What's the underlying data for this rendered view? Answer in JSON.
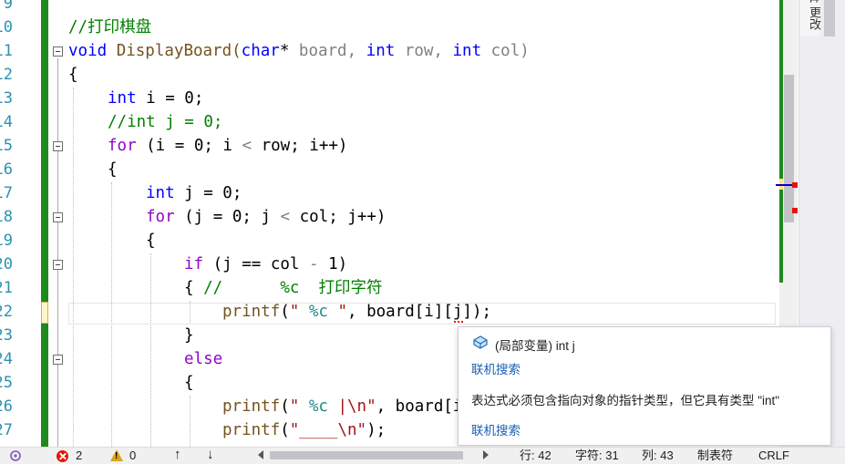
{
  "editor": {
    "line_numbers": [
      "9",
      "10",
      "11",
      "12",
      "13",
      "14",
      "15",
      "16",
      "17",
      "18",
      "19",
      "20",
      "21",
      "22",
      "23",
      "24",
      "25",
      "26",
      "27"
    ],
    "lines": [
      {
        "comment": "//打印棋盘"
      },
      {
        "kw_void": "void",
        "fn_name": " DisplayBoard(",
        "ty_char": "char",
        "star": "*",
        "p1": " board, ",
        "kw_int1": "int",
        "p2": " row, ",
        "kw_int2": "int",
        "p3": " col)"
      },
      {
        "brace": "{"
      },
      {
        "kw": "int",
        "rest": " i = 0;"
      },
      {
        "comment": "//int j = 0;"
      },
      {
        "kw": "for",
        "rest_a": " (i = 0; i ",
        "lt": "<",
        "rest_b": " row; i++)"
      },
      {
        "brace": "{"
      },
      {
        "kw": "int",
        "rest": " j = 0;"
      },
      {
        "kw": "for",
        "rest_a": " (j = 0; j ",
        "lt": "<",
        "rest_b": " col; j++)"
      },
      {
        "brace": "{"
      },
      {
        "kw": "if",
        "rest_a": " (j == col ",
        "minus": "-",
        "rest_b": " 1)"
      },
      {
        "brace": "{",
        "comment": " //      %c  打印字符"
      },
      {
        "fn": "printf",
        "open": "(",
        "str_a": "\" ",
        "fmt": "%c",
        "str_b": " \"",
        "rest": ", board[i][j]);"
      },
      {
        "brace": "}"
      },
      {
        "kw": "else"
      },
      {
        "brace": "{"
      },
      {
        "fn": "printf",
        "open": "(",
        "str_a": "\" ",
        "fmt": "%c",
        "str_b": " |\\n\"",
        "rest": ", board[i"
      },
      {
        "fn": "printf",
        "open": "(",
        "str_a": "\"____\\n\"",
        "rest": ");"
      }
    ]
  },
  "right_panel": {
    "tab_label": "t 更改"
  },
  "tooltip": {
    "symbol_line": "(局部变量) int j",
    "link1": "联机搜索",
    "error_message": "表达式必须包含指向对象的指针类型，但它具有类型 \"int\"",
    "link2": "联机搜索"
  },
  "statusbar": {
    "error_count": "2",
    "warning_count": "0",
    "up_arrow": "↑",
    "down_arrow": "↓",
    "line": "行: 42",
    "char": "字符: 31",
    "col": "列: 43",
    "tabs": "制表符",
    "eol": "CRLF"
  },
  "colors": {
    "keyword": "#0000ff",
    "type": "#2b91af",
    "comment": "#008000",
    "string": "#a31515",
    "control": "#8f08c4",
    "change_bar": "#1d8a1d",
    "error": "#e51400",
    "link": "#1a5fb4"
  }
}
